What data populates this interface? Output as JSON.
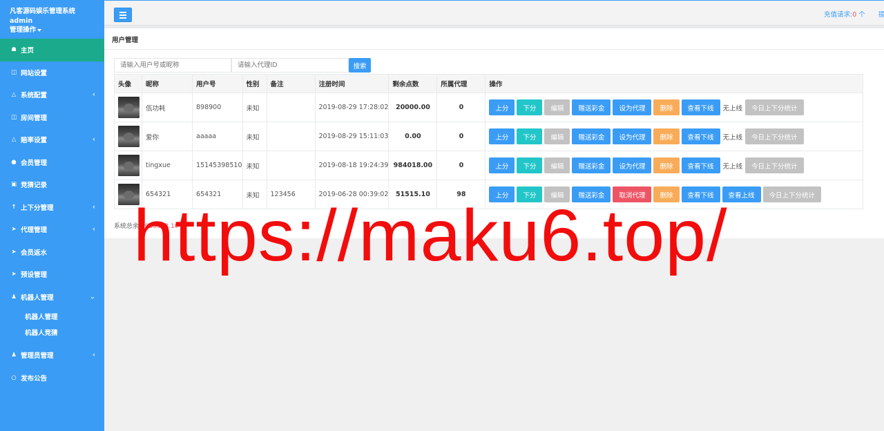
{
  "sidebar": {
    "title": "凡客源码娱乐管理系统",
    "user": "admin",
    "ops_label": "管理操作",
    "items": [
      {
        "label": "主页",
        "icon": "home-icon"
      },
      {
        "label": "网站设置",
        "icon": "columns-icon"
      },
      {
        "label": "系统配置",
        "icon": "flask-icon"
      },
      {
        "label": "房间管理",
        "icon": "columns-icon"
      },
      {
        "label": "赔率设置",
        "icon": "flask-icon"
      },
      {
        "label": "会员管理",
        "icon": "user-icon"
      },
      {
        "label": "竞猜记录",
        "icon": "car-icon"
      },
      {
        "label": "上下分管理",
        "icon": "level-up-icon"
      },
      {
        "label": "代理管理",
        "icon": "paper-plane-icon"
      },
      {
        "label": "会员返水",
        "icon": "paper-plane-icon"
      },
      {
        "label": "预设管理",
        "icon": "paper-plane-icon"
      },
      {
        "label": "机器人管理",
        "icon": "male-icon"
      },
      {
        "label": "管理员管理",
        "icon": "male-icon"
      },
      {
        "label": "发布公告",
        "icon": "comment-icon"
      }
    ],
    "robot_sub": [
      "机器人管理",
      "机器人竞猜"
    ]
  },
  "topbar": {
    "recharge_label": "充值请求:",
    "recharge_count": "0",
    "recharge_unit": " 个",
    "cut_text": "提"
  },
  "page": {
    "title": "用户管理",
    "search_placeholder_user": "请输入用户号或昵称",
    "search_placeholder_agent": "请输入代理ID",
    "search_label": "搜索"
  },
  "table": {
    "headers": [
      "头像",
      "昵称",
      "用户号",
      "性别",
      "备注",
      "注册时间",
      "剩余点数",
      "所属代理",
      "操作"
    ],
    "rows": [
      {
        "nickname": "佤功耗",
        "user_id": "898900",
        "gender": "未知",
        "note": "",
        "reg_time": "2019-08-29 17:28:02",
        "points": "20000.00",
        "agent": "0",
        "agent_action": "设为代理",
        "online": "无上线",
        "stats": "今日上下分统计"
      },
      {
        "nickname": "爱你",
        "user_id": "aaaaa",
        "gender": "未知",
        "note": "",
        "reg_time": "2019-08-29 15:11:03",
        "points": "0.00",
        "agent": "0",
        "agent_action": "设为代理",
        "online": "无上线",
        "stats": "今日上下分统计"
      },
      {
        "nickname": "tingxue",
        "user_id": "15145398510",
        "gender": "未知",
        "note": "",
        "reg_time": "2019-08-18 19:24:39",
        "points": "984018.00",
        "agent": "0",
        "agent_action": "设为代理",
        "online": "无上线",
        "stats": "今日上下分统计"
      },
      {
        "nickname": "654321",
        "user_id": "654321",
        "gender": "未知",
        "note": "123456",
        "reg_time": "2019-06-28 00:39:02",
        "points": "51515.10",
        "agent": "98",
        "agent_action": "取消代理",
        "online": "查看上线",
        "stats": "今日上下分统计"
      }
    ],
    "actions": {
      "up": "上分",
      "down": "下分",
      "edit": "编辑",
      "gift": "赠送彩金",
      "delete": "删除",
      "view_down": "查看下线"
    }
  },
  "summary": {
    "label": "系统总余",
    "value": "1055533.10"
  },
  "watermark": "https://maku6.top/",
  "colors": {
    "sidebar": "#3a9cf5",
    "active": "#1bab8c",
    "blue": "#3a9cf5",
    "teal": "#23c6c8",
    "gray": "#c2c2c2",
    "orange": "#f8ac59",
    "red": "#ed5565",
    "watermark": "#f20d0d"
  }
}
